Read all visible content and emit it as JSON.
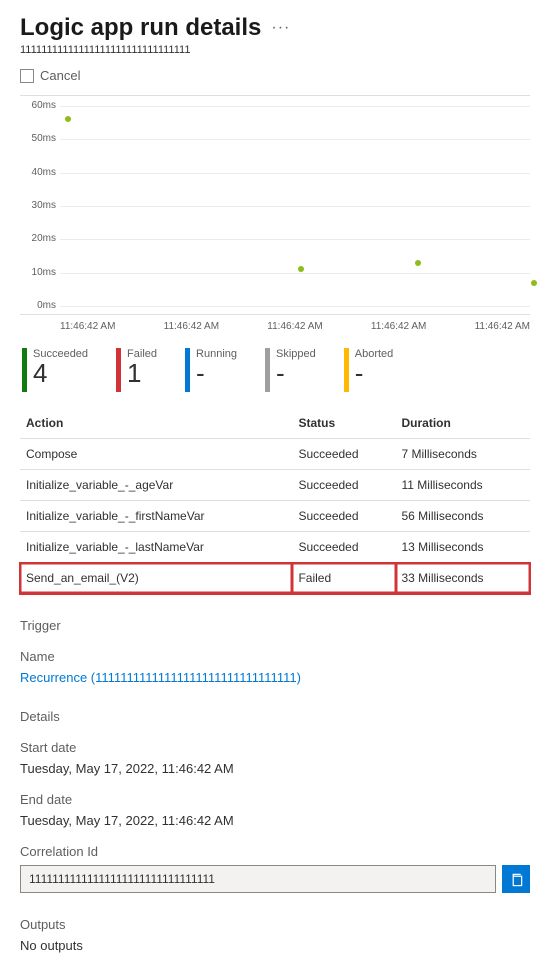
{
  "header": {
    "title": "Logic app run details",
    "run_id": "11111111111111111111111111111111"
  },
  "command_bar": {
    "cancel": "Cancel"
  },
  "chart_data": {
    "type": "scatter",
    "ylabel": "",
    "xlabel": "",
    "y_ticks": [
      "60ms",
      "50ms",
      "40ms",
      "30ms",
      "20ms",
      "10ms",
      "0ms"
    ],
    "x_ticks": [
      "11:46:42 AM",
      "11:46:42 AM",
      "11:46:42 AM",
      "11:46:42 AM",
      "11:46:42 AM"
    ],
    "ylim": [
      0,
      60
    ],
    "points": [
      {
        "x_index": 0,
        "y_ms": 56
      },
      {
        "x_index": 2,
        "y_ms": 11
      },
      {
        "x_index": 3,
        "y_ms": 13
      },
      {
        "x_index": 4,
        "y_ms": 7
      }
    ]
  },
  "status_cards": [
    {
      "label": "Succeeded",
      "value": "4",
      "color": "#107c10"
    },
    {
      "label": "Failed",
      "value": "1",
      "color": "#d13438"
    },
    {
      "label": "Running",
      "value": "-",
      "color": "#0078d4"
    },
    {
      "label": "Skipped",
      "value": "-",
      "color": "#a19f9d"
    },
    {
      "label": "Aborted",
      "value": "-",
      "color": "#ffb900"
    }
  ],
  "actions_table": {
    "headers": {
      "action": "Action",
      "status": "Status",
      "duration": "Duration"
    },
    "rows": [
      {
        "action": "Compose",
        "status": "Succeeded",
        "duration": "7 Milliseconds",
        "highlighted": false
      },
      {
        "action": "Initialize_variable_-_ageVar",
        "status": "Succeeded",
        "duration": "11 Milliseconds",
        "highlighted": false
      },
      {
        "action": "Initialize_variable_-_firstNameVar",
        "status": "Succeeded",
        "duration": "56 Milliseconds",
        "highlighted": false
      },
      {
        "action": "Initialize_variable_-_lastNameVar",
        "status": "Succeeded",
        "duration": "13 Milliseconds",
        "highlighted": false
      },
      {
        "action": "Send_an_email_(V2)",
        "status": "Failed",
        "duration": "33 Milliseconds",
        "highlighted": true
      }
    ]
  },
  "trigger": {
    "section_label": "Trigger",
    "name_label": "Name",
    "name_link": "Recurrence  (11111111111111111111111111111111)"
  },
  "details": {
    "section_label": "Details",
    "start_label": "Start date",
    "start_value": "Tuesday, May 17, 2022, 11:46:42 AM",
    "end_label": "End date",
    "end_value": "Tuesday, May 17, 2022, 11:46:42 AM",
    "corr_label": "Correlation Id",
    "corr_value": "11111111111111111111111111111111"
  },
  "outputs": {
    "section_label": "Outputs",
    "empty_text": "No outputs"
  },
  "icons": {
    "copy": "copy-icon"
  }
}
